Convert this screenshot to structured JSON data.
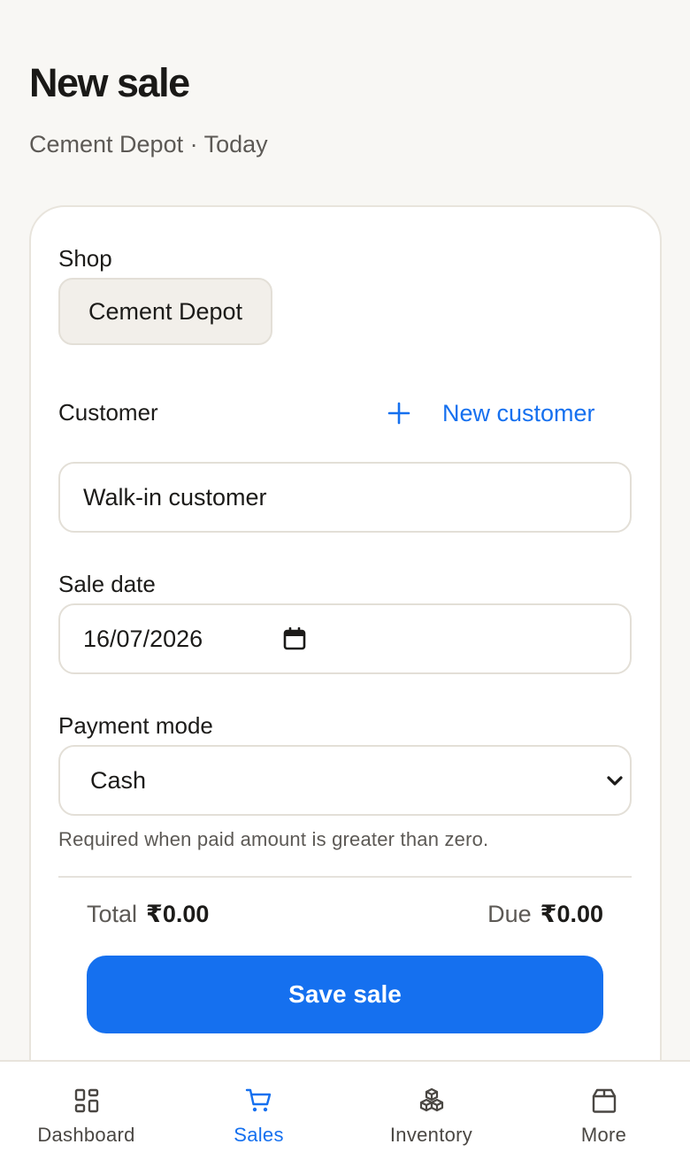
{
  "header": {
    "title": "New sale",
    "subtitle": "Cement Depot · Today"
  },
  "form": {
    "shop": {
      "label": "Shop",
      "value": "Cement Depot"
    },
    "customer": {
      "label": "Customer",
      "new_customer_label": "New customer",
      "value": "Walk-in customer"
    },
    "sale_date": {
      "label": "Sale date",
      "value": "16/07/2026"
    },
    "payment_mode": {
      "label": "Payment mode",
      "selected": "Cash",
      "hint": "Required when paid amount is greater than zero."
    }
  },
  "summary": {
    "total_label": "Total",
    "total_value": "₹0.00",
    "due_label": "Due",
    "due_value": "₹0.00"
  },
  "actions": {
    "save_label": "Save sale"
  },
  "nav": {
    "items": [
      {
        "label": "Dashboard",
        "icon": "dashboard-icon",
        "active": false
      },
      {
        "label": "Sales",
        "icon": "cart-icon",
        "active": true
      },
      {
        "label": "Inventory",
        "icon": "boxes-icon",
        "active": false
      },
      {
        "label": "More",
        "icon": "archive-box-icon",
        "active": false
      }
    ]
  },
  "colors": {
    "accent": "#1570ef",
    "background": "#f8f7f4",
    "card": "#ffffff",
    "border": "#e3dfd7"
  }
}
